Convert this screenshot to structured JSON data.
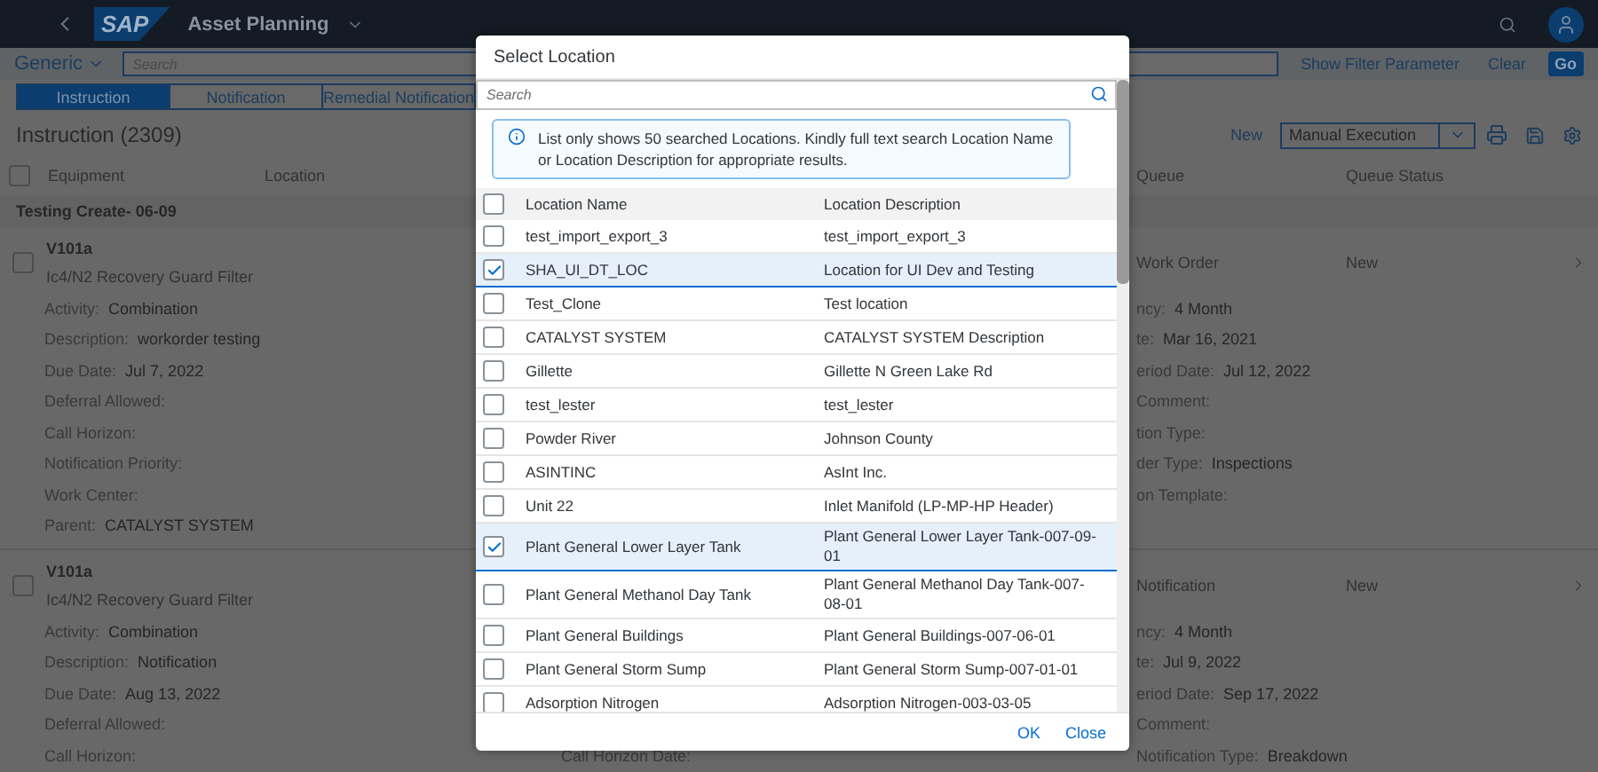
{
  "shell": {
    "logo": "SAP",
    "title": "Asset Planning"
  },
  "filter_bar": {
    "variant": "Generic",
    "search": {
      "placeholder": "Search"
    },
    "buttons": [
      {
        "label": "Show Filter Parameter",
        "kind": "link"
      },
      {
        "label": "Clear",
        "kind": "link"
      },
      {
        "label": "Go",
        "kind": "emphasized"
      }
    ]
  },
  "tabs": [
    {
      "label": "Instruction",
      "selected": true
    },
    {
      "label": "Notification",
      "selected": false
    },
    {
      "label": "Remedial Notification",
      "selected": false
    }
  ],
  "toolbar": {
    "title": "Instruction (2309)",
    "new_label": "New",
    "execution_select": "Manual Execution"
  },
  "table": {
    "select_all_checked": false,
    "left_columns": [
      "Equipment",
      "Location"
    ],
    "right_columns": [
      "Queue",
      "Queue Status"
    ],
    "group_title": "Testing Create- 06-09",
    "items": [
      {
        "id": "V101a",
        "name": "Ic4/N2 Recovery Guard Filter",
        "queue": "Work Order",
        "queue_status": "New",
        "selected": false,
        "rows": [
          {
            "left": {
              "label": "Activity:",
              "value": "Combination"
            },
            "right": {
              "label": "ncy:",
              "value": "4 Month"
            }
          },
          {
            "left": {
              "label": "Description:",
              "value": "workorder testing"
            },
            "right": {
              "label": "te:",
              "value": "Mar 16, 2021"
            }
          },
          {
            "left": {
              "label": "Due Date:",
              "value": "Jul 7, 2022"
            },
            "right": {
              "label": "eriod Date:",
              "value": "Jul 12, 2022"
            }
          },
          {
            "left": {
              "label": "Deferral Allowed:"
            },
            "right": {
              "label": "Comment:"
            }
          },
          {
            "left": {
              "label": "Call Horizon:"
            },
            "right": {
              "label": "tion Type:"
            }
          },
          {
            "left": {
              "label": "Notification Priority:"
            },
            "right": {
              "label": "der Type:",
              "value": "Inspections"
            }
          },
          {
            "left": {
              "label": "Work Center:"
            },
            "right": {
              "label": "on Template:"
            }
          },
          {
            "left": {
              "label": "Parent:",
              "value": "CATALYST SYSTEM"
            }
          }
        ]
      },
      {
        "id": "V101a",
        "name": "Ic4/N2 Recovery Guard Filter",
        "queue": "Notification",
        "queue_status": "New",
        "selected": false,
        "rows": [
          {
            "left": {
              "label": "Activity:",
              "value": "Combination"
            },
            "right": {
              "label": "ncy:",
              "value": "4 Month"
            }
          },
          {
            "left": {
              "label": "Description:",
              "value": "Notification"
            },
            "right": {
              "label": "te:",
              "value": "Jul 9, 2022"
            }
          },
          {
            "left": {
              "label": "Due Date:",
              "value": "Aug 13, 2022"
            },
            "right": {
              "label": "eriod Date:",
              "value": "Sep 17, 2022"
            }
          },
          {
            "left": {
              "label": "Deferral Allowed:"
            },
            "right": {
              "label": "Comment:"
            }
          },
          {
            "left": {
              "label": "Call Horizon:"
            },
            "middle": {
              "label": "Call Horizon Date:"
            },
            "right": {
              "label": "Notification Type:",
              "value": "Breakdown"
            }
          }
        ]
      }
    ]
  },
  "dialog": {
    "title": "Select Location",
    "search": {
      "placeholder": "Search"
    },
    "info": "List only shows 50 searched Locations. Kindly full text search Location Name or Location Description for appropriate results.",
    "columns": [
      "Location Name",
      "Location Description"
    ],
    "select_all_checked": false,
    "rows": [
      {
        "name": "test_import_export_3",
        "description": "test_import_export_3",
        "selected": false
      },
      {
        "name": "SHA_UI_DT_LOC",
        "description": "Location for UI Dev and Testing",
        "selected": true
      },
      {
        "name": "Test_Clone",
        "description": "Test location",
        "selected": false
      },
      {
        "name": "CATALYST SYSTEM",
        "description": "CATALYST SYSTEM Description",
        "selected": false
      },
      {
        "name": "Gillette",
        "description": "Gillette N Green Lake Rd",
        "selected": false
      },
      {
        "name": "test_lester",
        "description": "test_lester",
        "selected": false
      },
      {
        "name": "Powder River",
        "description": "Johnson County",
        "selected": false
      },
      {
        "name": "ASINTINC",
        "description": "AsInt Inc.",
        "selected": false
      },
      {
        "name": "Unit 22",
        "description": "Inlet Manifold (LP-MP-HP Header)",
        "selected": false
      },
      {
        "name": "Plant General Lower Layer Tank",
        "description": "Plant General Lower Layer Tank-007-09-01",
        "selected": true
      },
      {
        "name": "Plant General Methanol Day Tank",
        "description": "Plant General Methanol Day Tank-007-08-01",
        "selected": false
      },
      {
        "name": "Plant General Buildings",
        "description": "Plant General Buildings-007-06-01",
        "selected": false
      },
      {
        "name": "Plant General Storm Sump",
        "description": "Plant General Storm Sump-007-01-01",
        "selected": false
      },
      {
        "name": "Adsorption Nitrogen",
        "description": "Adsorption Nitrogen-003-03-05",
        "selected": false
      }
    ],
    "buttons": [
      "OK",
      "Close"
    ]
  }
}
